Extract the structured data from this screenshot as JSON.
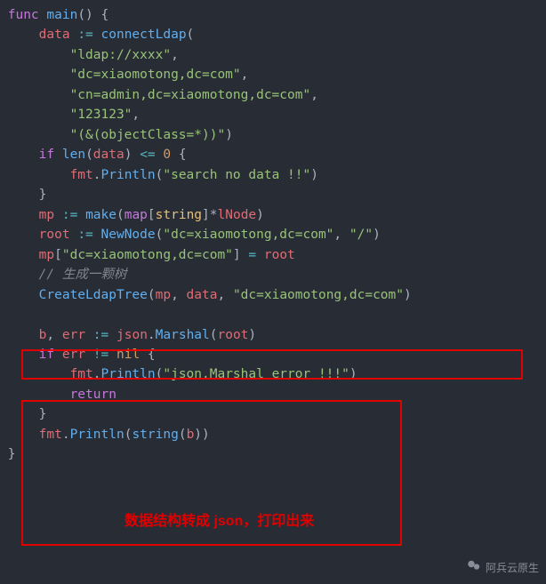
{
  "code": {
    "l1": {
      "kw": "func",
      "fn": "main",
      "p": "() {"
    },
    "l2": {
      "v": "data",
      "op": ":=",
      "fn": "connectLdap",
      "p": "("
    },
    "l3": {
      "s": "\"ldap://xxxx\"",
      "c": ","
    },
    "l4": {
      "s": "\"dc=xiaomotong,dc=com\"",
      "c": ","
    },
    "l5": {
      "s": "\"cn=admin,dc=xiaomotong,dc=com\"",
      "c": ","
    },
    "l6": {
      "s": "\"123123\"",
      "c": ","
    },
    "l7": {
      "s": "\"(&(objectClass=*))\"",
      "c": ")"
    },
    "l8": {
      "kw": "if",
      "fn": "len",
      "p1": "(",
      "v": "data",
      "p2": ")",
      "op": "<=",
      "n": "0",
      "p3": " {"
    },
    "l9": {
      "pkg": "fmt",
      "dot": ".",
      "fn": "Println",
      "p1": "(",
      "s": "\"search no data !!\"",
      "p2": ")"
    },
    "l10": {
      "p": "}"
    },
    "l11": {
      "v": "mp",
      "op": ":=",
      "fn": "make",
      "p1": "(",
      "kw2": "map",
      "p2": "[",
      "t1": "string",
      "p3": "]*",
      "t2": "lNode",
      "p4": ")"
    },
    "l12": {
      "v": "root",
      "op": ":=",
      "fn": "NewNode",
      "p1": "(",
      "s1": "\"dc=xiaomotong,dc=com\"",
      "c": ", ",
      "s2": "\"/\"",
      "p2": ")"
    },
    "l13": {
      "v": "mp",
      "p1": "[",
      "s": "\"dc=xiaomotong,dc=com\"",
      "p2": "]",
      "op": "=",
      "v2": "root"
    },
    "l14": {
      "cmt": "// 生成一颗树"
    },
    "l15": {
      "fn": "CreateLdapTree",
      "p1": "(",
      "v1": "mp",
      "c1": ", ",
      "v2": "data",
      "c2": ", ",
      "s": "\"dc=xiaomotong,dc=com\"",
      "p2": ")"
    },
    "l16": {
      "v1": "b",
      "c": ", ",
      "v2": "err",
      "op": ":=",
      "pkg": "json",
      "dot": ".",
      "fn": "Marshal",
      "p1": "(",
      "v3": "root",
      "p2": ")"
    },
    "l17": {
      "kw": "if",
      "v": "err",
      "op": "!=",
      "n": "nil",
      "p": " {"
    },
    "l18": {
      "pkg": "fmt",
      "dot": ".",
      "fn": "Println",
      "p1": "(",
      "s": "\"json.Marshal error !!!\"",
      "p2": ")"
    },
    "l19": {
      "kw": "return"
    },
    "l20": {
      "p": "}"
    },
    "l21": {
      "pkg": "fmt",
      "dot": ".",
      "fn": "Println",
      "p1": "(",
      "fn2": "string",
      "p2": "(",
      "v": "b",
      "p3": "))"
    },
    "l22": {
      "p": "}"
    }
  },
  "annotation": "数据结构转成 json，打印出来",
  "watermark": "阿兵云原生"
}
